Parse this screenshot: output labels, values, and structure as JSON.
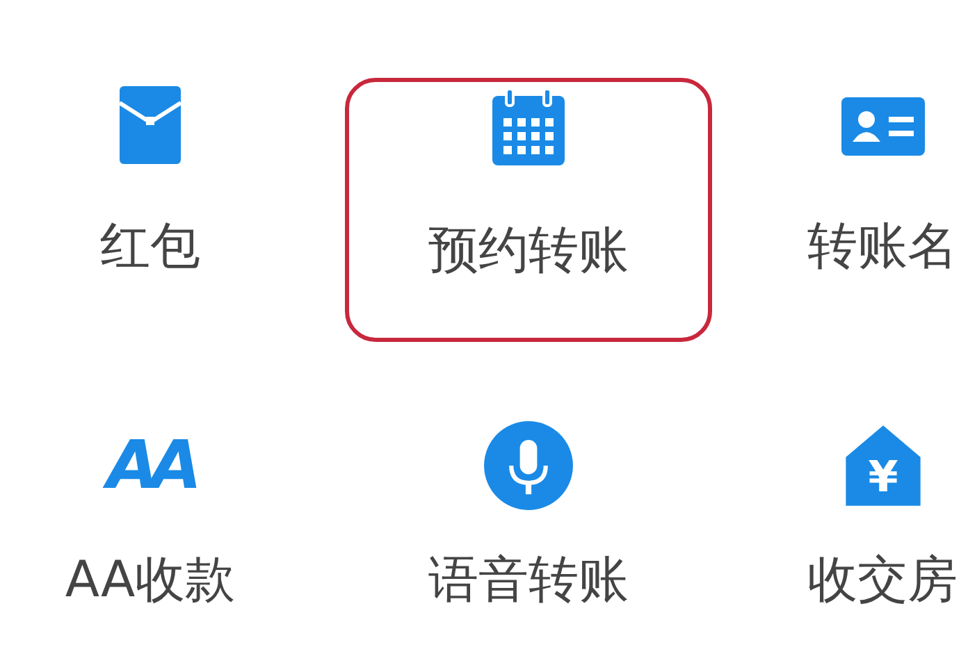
{
  "items": [
    {
      "kind": "envelope",
      "label": "红包",
      "highlighted": false
    },
    {
      "kind": "calendar",
      "label": "预约转账",
      "highlighted": true
    },
    {
      "kind": "card",
      "label": "转账名",
      "highlighted": false
    },
    {
      "kind": "letters",
      "icon_text": "AA",
      "label": "AA收款",
      "highlighted": false
    },
    {
      "kind": "mic",
      "label": "语音转账",
      "highlighted": false
    },
    {
      "kind": "house",
      "icon_text": "¥",
      "label": "收交房",
      "highlighted": false
    }
  ]
}
